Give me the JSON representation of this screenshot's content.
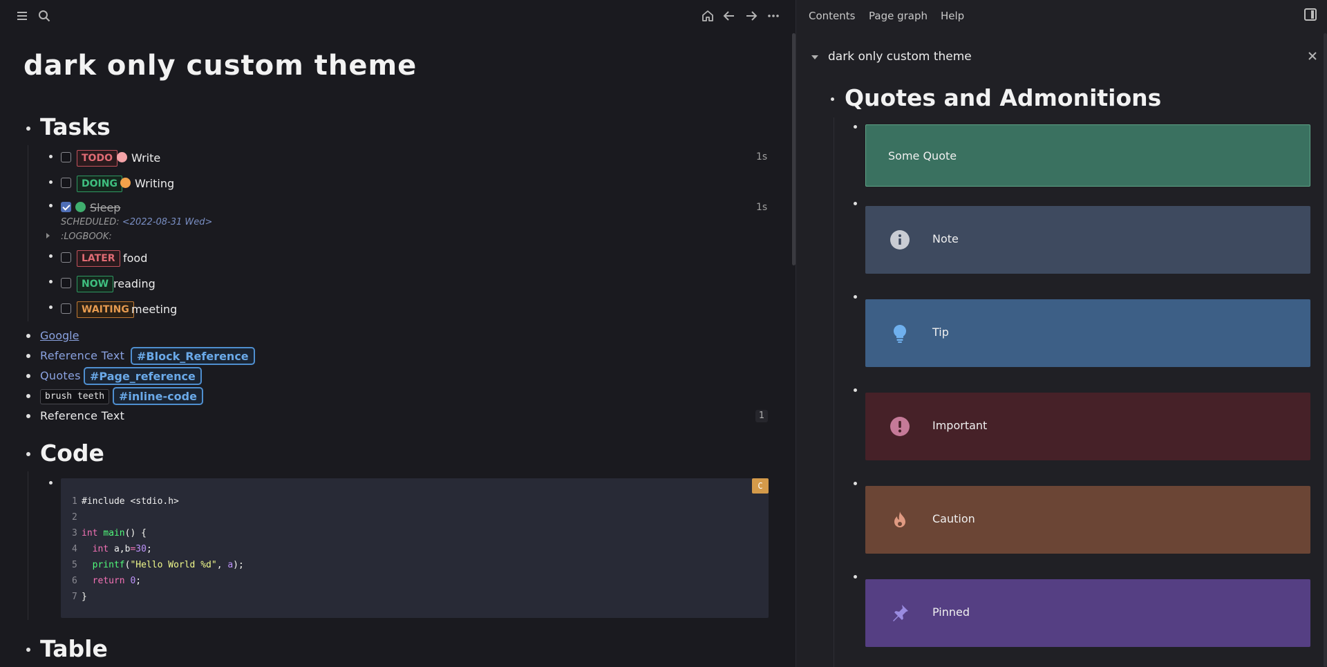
{
  "left": {
    "page_title": "dark only custom theme",
    "sections": {
      "tasks": "Tasks",
      "code": "Code",
      "table": "Table"
    },
    "tasks": [
      {
        "marker": "TODO",
        "priority_color": "#f4a3a8",
        "text": "Write",
        "timer": "1s",
        "checked": false
      },
      {
        "marker": "DOING",
        "priority_color": "#f2a24b",
        "text": "Writing",
        "timer": "",
        "checked": false
      },
      {
        "marker": "",
        "priority_color": "#3fae6e",
        "text": "Sleep",
        "timer": "1s",
        "checked": true,
        "scheduled_label": "SCHEDULED:",
        "scheduled_date": "<2022-08-31 Wed>",
        "logbook": ":LOGBOOK:"
      },
      {
        "marker": "LATER",
        "text": "food",
        "checked": false
      },
      {
        "marker": "NOW",
        "text": "reading",
        "checked": false
      },
      {
        "marker": "WAITING",
        "text": "meeting",
        "checked": false
      }
    ],
    "links": {
      "google": "Google",
      "ref_text": "Reference Text",
      "block_ref_tag": "#Block_Reference",
      "quotes": "Quotes",
      "page_ref_tag": "#Page_reference",
      "inline_code": "brush teeth",
      "inline_code_tag": "#inline-code",
      "ref_text_plain": "Reference Text",
      "ref_count": "1"
    },
    "code": {
      "lang": "C",
      "lines": [
        {
          "n": "1",
          "text": "#include <stdio.h>"
        },
        {
          "n": "2",
          "text": ""
        },
        {
          "n": "3",
          "text": "int main() {"
        },
        {
          "n": "4",
          "text": "  int a,b=30;"
        },
        {
          "n": "5",
          "text": "  printf(\"Hello World %d\", a);"
        },
        {
          "n": "6",
          "text": "  return 0;"
        },
        {
          "n": "7",
          "text": "}"
        }
      ]
    }
  },
  "right": {
    "tabs": [
      "Contents",
      "Page graph",
      "Help"
    ],
    "header_title": "dark only custom theme",
    "heading": "Quotes and Admonitions",
    "callouts": [
      {
        "label": "Some Quote",
        "color": "#3a7160",
        "icon": ""
      },
      {
        "label": "Note",
        "color": "#3e4a5f",
        "icon": "info-icon"
      },
      {
        "label": "Tip",
        "color": "#3d5f86",
        "icon": "lightbulb-icon"
      },
      {
        "label": "Important",
        "color": "#462128",
        "icon": "exclamation-icon"
      },
      {
        "label": "Caution",
        "color": "#6b4535",
        "icon": "flame-icon"
      },
      {
        "label": "Pinned",
        "color": "#553f83",
        "icon": "pin-icon"
      }
    ]
  }
}
